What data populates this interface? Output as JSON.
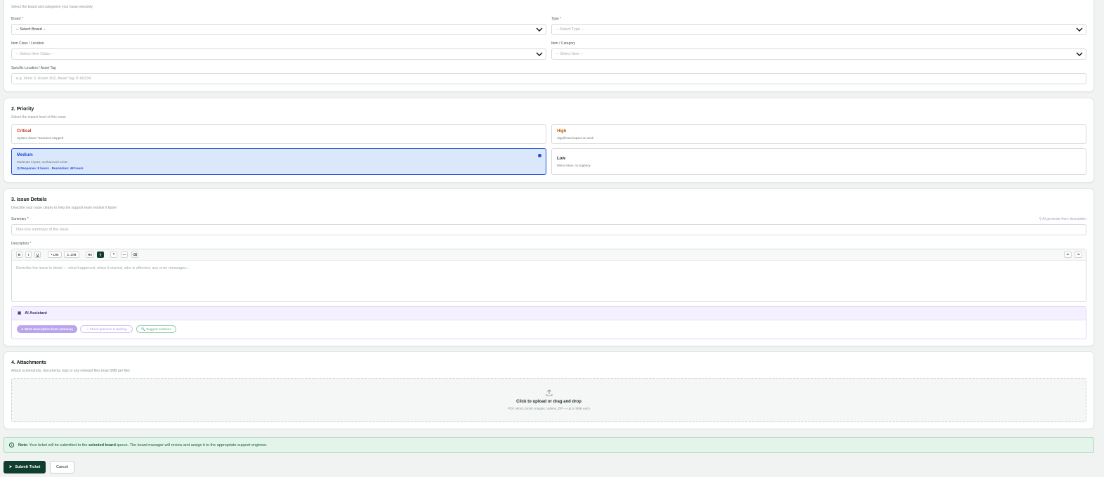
{
  "section1": {
    "subtitle": "Select the board and categorize your issue precisely",
    "board_label": "Board",
    "board_value": "-- Select Board --",
    "type_label": "Type",
    "type_value": "-- Select Type --",
    "item_class_label": "Item Class / Location",
    "item_class_value": "-- Select Item Class --",
    "item_category_label": "Item / Category",
    "item_category_value": "-- Select Item --",
    "location_label": "Specific Location / Asset Tag",
    "location_placeholder": "e.g. Floor 3, Room 302, Asset Tag IT-00234",
    "required_mark": "*"
  },
  "section2": {
    "title": "2. Priority",
    "subtitle": "Select the impact level of this issue",
    "critical_title": "Critical",
    "critical_desc": "System down / Business stopped",
    "high_title": "High",
    "high_desc": "Significant impact on work",
    "medium_title": "Medium",
    "medium_desc": "Moderate impact, workaround exists",
    "medium_sla": "Response: 8 hours · Resolution: 48 hours",
    "low_title": "Low",
    "low_desc": "Minor issue, no urgency",
    "selected": "Medium",
    "colors": {
      "critical": "#c0392b",
      "high": "#b35a00",
      "medium": "#1d4ed8",
      "low": "#1d2b24"
    }
  },
  "section3": {
    "title": "3. Issue Details",
    "subtitle": "Describe your issue clearly to help the support team resolve it faster",
    "summary_label": "Summary",
    "ai_generate": "AI generate from description",
    "summary_placeholder": "One-line summary of the issue",
    "description_label": "Description",
    "toolbar": {
      "bold": "B",
      "italic": "I",
      "underline": "U",
      "bullet_list": "• List",
      "numbered_list": "1. List",
      "h3": "H3",
      "paragraph": "¶",
      "quote": "❝",
      "rule": "—",
      "clear": "⌫",
      "undo": "↶",
      "redo": "↷"
    },
    "description_placeholder": "Describe the issue in detail — what happened, when it started, who is affected, any error messages...",
    "ai_assistant_title": "AI Assistant",
    "ai_write": "✦ Write description from summary",
    "ai_check": "✓ Check grammar & spelling",
    "ai_suggest": "🔍 Suggest solutions"
  },
  "section4": {
    "title": "4. Attachments",
    "subtitle": "Attach screenshots, documents, logs or any relevant files (max 5MB per file)",
    "upload_title": "Click to upload or drag and drop",
    "upload_sub": "PDF, Word, Excel, Images, Videos, ZIP — up to 5MB each"
  },
  "note": {
    "prefix": "Note:",
    "text1": " Your ticket will be submitted to the ",
    "bold": "selected board",
    "text2": " queue. The board manager will review and assign it to the appropriate support engineer."
  },
  "actions": {
    "submit": "Submit Ticket",
    "cancel": "Cancel"
  },
  "brand_color": "#0f3d2e"
}
